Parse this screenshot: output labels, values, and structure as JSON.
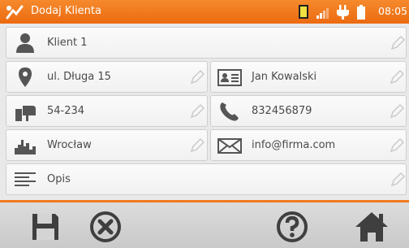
{
  "header": {
    "title": "Dodaj Klienta",
    "time": "08:05",
    "icons": [
      "app-logo-icon",
      "memory-card-icon",
      "signal-icon",
      "plug-icon",
      "battery-icon"
    ],
    "accent": "#f07a1e"
  },
  "form": {
    "client_name": "Klient 1",
    "street": "ul. Długa 15",
    "contact_person": "Jan Kowalski",
    "postal_code": "54-234",
    "phone": "832456879",
    "city": "Wrocław",
    "email": "info@firma.com",
    "description_placeholder": "Opis"
  },
  "toolbar": {
    "buttons": [
      "save-icon",
      "cancel-icon",
      "help-icon",
      "home-icon"
    ]
  }
}
